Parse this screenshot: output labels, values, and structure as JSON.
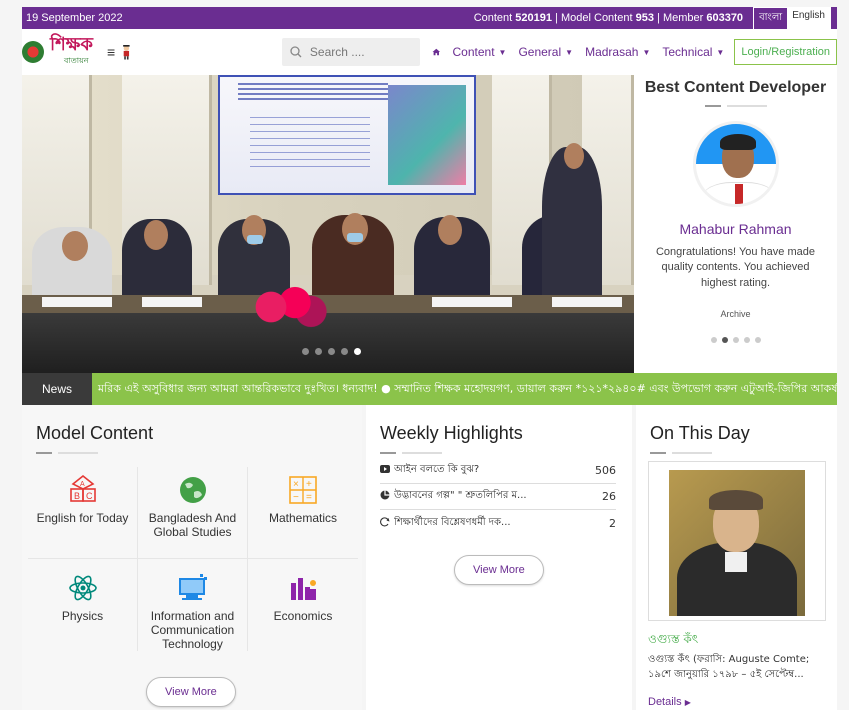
{
  "topbar": {
    "date": "19 September 2022",
    "content_label": "Content",
    "content_count": "520191",
    "model_label": "Model Content",
    "model_count": "953",
    "member_label": "Member",
    "member_count": "603370",
    "lang_bn": "বাংলা",
    "lang_en": "English"
  },
  "navbar": {
    "logo_text": "শিক্ষক",
    "logo_sub": "বাতায়ন",
    "search_placeholder": "Search ....",
    "items": [
      {
        "label": "Content"
      },
      {
        "label": "General"
      },
      {
        "label": "Madrasah"
      },
      {
        "label": "Technical"
      }
    ],
    "login": "Login/Registration"
  },
  "best_developer": {
    "title": "Best Content Developer",
    "name": "Mahabur Rahman",
    "message": "Congratulations! You have made quality contents. You achieved highest rating.",
    "archive": "Archive"
  },
  "news": {
    "label": "News",
    "text": "মরিক এই অসুবিধার জন্য আমরা আন্তরিকভাবে দুঃখিত। ধন্যবাদ! ● সম্মানিত শিক্ষক মহোদয়গণ, ডায়াল করুন *১২১*২৯৪০# এবং উপভোগ করুন এটুআই-জিপির আকর্ষণীয় অ"
  },
  "model_content": {
    "title": "Model Content",
    "subjects": [
      {
        "label": "English for Today",
        "icon": "abc-blocks-icon"
      },
      {
        "label": "Bangladesh And Global Studies",
        "icon": "globe-icon"
      },
      {
        "label": "Mathematics",
        "icon": "calculator-icon"
      },
      {
        "label": "Physics",
        "icon": "atom-icon"
      },
      {
        "label": "Information and Communication Technology",
        "icon": "computer-icon"
      },
      {
        "label": "Economics",
        "icon": "economics-chart-icon"
      }
    ],
    "view_more": "View More"
  },
  "weekly": {
    "title": "Weekly Highlights",
    "items": [
      {
        "icon": "video-icon",
        "title": "আইন বলতে কি বুঝ?",
        "count": "506"
      },
      {
        "icon": "pie-icon",
        "title": "উদ্ভাবনের গল্প\" \" শ্রুতলিপির ম...",
        "count": "26"
      },
      {
        "icon": "refresh-icon",
        "title": "শিক্ষার্থীদের বিশ্লেষণধর্মী দক...",
        "count": "2"
      }
    ],
    "view_more": "View More"
  },
  "on_this_day": {
    "title": "On This Day",
    "name": "ওগ্যুস্ত কঁৎ",
    "description": "ওগ্যুস্ত কঁৎ (ফরাসি: Auguste Comte; ১৯শে জানুয়ারি ১৭৯৮ – ৫ই সেপ্টেম্ব...",
    "details": "Details"
  },
  "colors": {
    "brand_purple": "#6a2d91",
    "news_green": "#8bc34a",
    "accent_green": "#4caf50"
  }
}
